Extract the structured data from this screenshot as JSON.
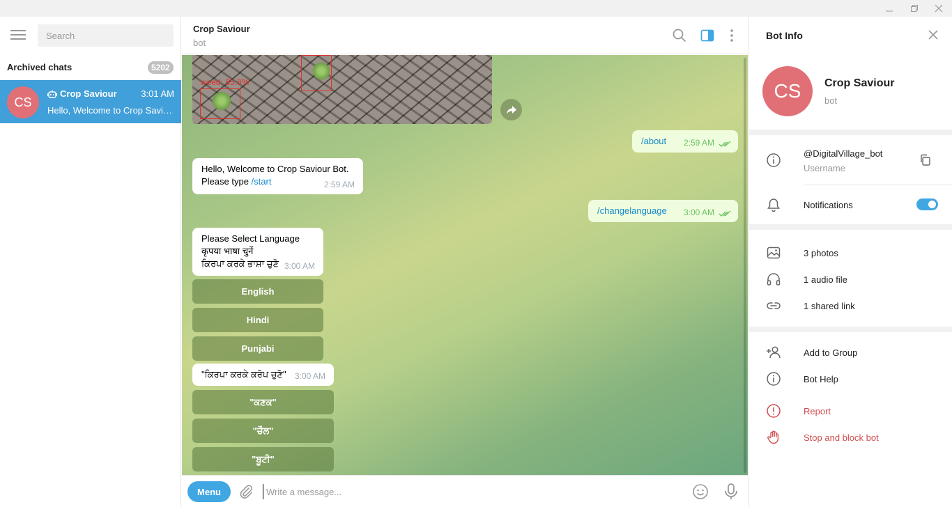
{
  "colors": {
    "accent": "#40a7e3",
    "avatar": "#e17076",
    "danger": "#d14e4e",
    "selected": "#419fd9"
  },
  "left": {
    "search_placeholder": "Search",
    "archived_label": "Archived chats",
    "archived_count": "5202",
    "chat": {
      "avatar": "CS",
      "name": "Crop Saviour",
      "time": "3:01 AM",
      "preview": "Hello, Welcome to Crop Saviour Bot. Please type /start"
    }
  },
  "header": {
    "title": "Crop Saviour",
    "subtitle": "bot"
  },
  "photo": {
    "label": "weed: 85.8%"
  },
  "messages": [
    {
      "text": "/about",
      "time": "2:59 AM"
    },
    {
      "line1": "Hello, Welcome to Crop Saviour Bot.",
      "line2_prefix": "Please type ",
      "line2_link": "/start",
      "time": "2:59 AM"
    },
    {
      "text": "/changelanguage",
      "time": "3:00 AM"
    },
    {
      "line1": "Please Select Language",
      "line2": "कृपया भाषा चुनें",
      "line3": "ਕਿਰਪਾ ਕਰਕੇ ਭਾਸ਼ਾ ਚੁਣੋ",
      "time": "3:00 AM"
    },
    {
      "text": "\"ਕਿਰਪਾ ਕਰਕੇ ਕਰੋਪ ਚੁਣੋ\"",
      "time": "3:00 AM"
    }
  ],
  "language_buttons": [
    "English",
    "Hindi",
    "Punjabi"
  ],
  "crop_buttons": [
    "\"ਕਣਕ\"",
    "\"ਚੌਲ\"",
    "\"ਬੂਟੀ\""
  ],
  "composer": {
    "menu_label": "Menu",
    "placeholder": "Write a message..."
  },
  "info": {
    "title": "Bot Info",
    "avatar": "CS",
    "name": "Crop Saviour",
    "subtitle": "bot",
    "username": "@DigitalVillage_bot",
    "username_label": "Username",
    "notifications_label": "Notifications",
    "notifications_on": true,
    "media": [
      "3 photos",
      "1 audio file",
      "1 shared link"
    ],
    "actions": [
      "Add to Group",
      "Bot Help"
    ],
    "danger_actions": [
      "Report",
      "Stop and block bot"
    ]
  }
}
